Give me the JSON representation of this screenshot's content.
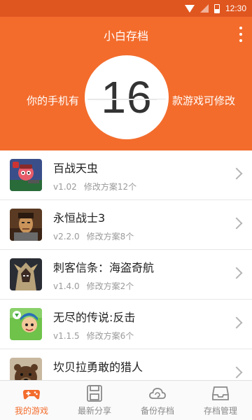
{
  "status_bar": {
    "time": "12:30"
  },
  "header": {
    "title": "小白存档",
    "count": "16",
    "left_text": "你的手机有",
    "right_text": "款游戏可修改"
  },
  "colors": {
    "accent": "#f36c2c",
    "status_bar": "#e0561f"
  },
  "games": [
    {
      "name": "百战天虫",
      "version": "v1.02",
      "plans": "修改方案12个",
      "icon": "worms-game-icon"
    },
    {
      "name": "永恒战士3",
      "version": "v2.2.0",
      "plans": "修改方案8个",
      "icon": "eternity-warriors-game-icon"
    },
    {
      "name": "刺客信条：海盗奇航",
      "version": "v1.4.0",
      "plans": "修改方案2个",
      "icon": "assassins-creed-game-icon"
    },
    {
      "name": "无尽的传说:反击",
      "version": "v1.1.5",
      "plans": "修改方案6个",
      "icon": "endless-legend-game-icon"
    },
    {
      "name": "坎贝拉勇敢的猎人",
      "version": "",
      "plans": "",
      "icon": "bear-hunter-game-icon"
    }
  ],
  "tabs": [
    {
      "label": "我的游戏",
      "icon": "gamepad-icon",
      "active": true
    },
    {
      "label": "最新分享",
      "icon": "floppy-disk-icon",
      "active": false
    },
    {
      "label": "备份存档",
      "icon": "cloud-sync-icon",
      "active": false
    },
    {
      "label": "存档管理",
      "icon": "inbox-tray-icon",
      "active": false
    }
  ]
}
